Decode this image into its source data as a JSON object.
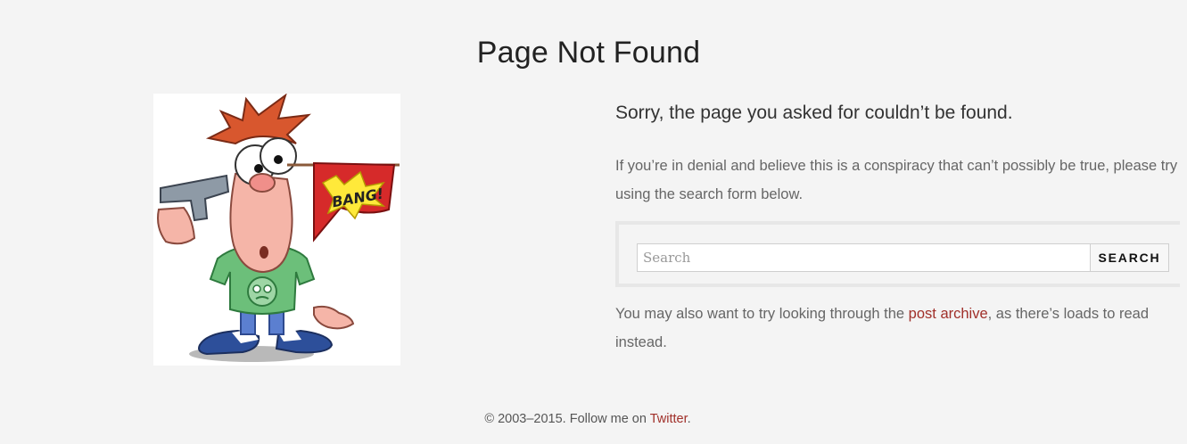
{
  "page": {
    "title": "Page Not Found"
  },
  "illustration": {
    "flag_text": "BANG!"
  },
  "content": {
    "lead": "Sorry, the page you asked for couldn’t be found.",
    "intro": "If you’re in denial and believe this is a conspiracy that can’t possibly be true, please try using the search form below.",
    "search": {
      "placeholder": "Search",
      "value": "",
      "button_label": "SEARCH"
    },
    "archive_prefix": "You may also want to try looking through the ",
    "archive_link": "post archive",
    "archive_suffix": ", as there’s loads to read instead."
  },
  "footer": {
    "prefix": "© 2003–2015. Follow me on ",
    "twitter_link": "Twitter",
    "suffix": "."
  },
  "colors": {
    "background": "#f4f4f4",
    "link": "#a0302a",
    "search_border": "#e7e7e7"
  }
}
